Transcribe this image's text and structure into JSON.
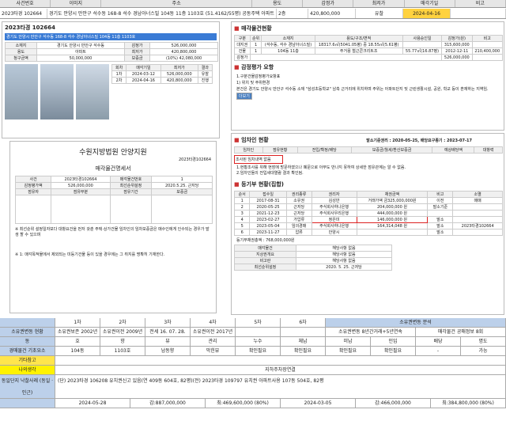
{
  "header": [
    "사건번호",
    "이미지",
    "주소",
    "용도",
    "감정가",
    "최저가",
    "매각기일",
    "비고"
  ],
  "summary": {
    "case": "2023타경 102664",
    "addr": "경기도 안양시 만안구 석수동 168-8 석수 경남아너스빌 104동 11층 1103호 (51.4162/55평) 공동주택 아파트",
    "area": "2층",
    "appraisal": "420,800,000",
    "stage": "유찰",
    "status": "2024-04-16"
  },
  "left": {
    "title": "2023타경 102664",
    "tags": "경기도 안양시 만안구 석수동 168-8 석수 경남아너스빌 104동 11층 1103호",
    "rows": [
      [
        "소재지",
        "경기도 안양시 만안구 석수동"
      ],
      [
        "용도",
        "아파트"
      ],
      [
        "감정가",
        "526,000,000"
      ],
      [
        "최저가",
        "420,800,000"
      ],
      [
        "보증금",
        "(10%) 42,080,000"
      ],
      [
        "청구금액",
        "50,000,000"
      ]
    ],
    "bid": [
      [
        "1차",
        "2024-03-12",
        "526,000,000",
        "유찰"
      ],
      [
        "2차",
        "2024-04-16",
        "420,800,000",
        "진행"
      ]
    ]
  },
  "notice": {
    "court": "수원지방법원 안양지원",
    "no": "2023타경102664",
    "title": "매각물건명세서",
    "note": "※ 최선순위 설정일자보다 대항요건을 먼저 갖춘 주택·상가건물 임차인의 임차보증금은 매수인에게 인수되는 경우가 발생 할 수 있으며",
    "foot": "※ 1: 매각목적물에서 제외되는 미등기건물 등이 있을 경우에는 그 취지를 명확히 기재한다."
  },
  "rights": {
    "title": "매각물건현황",
    "cols": [
      "구분",
      "순위",
      "소재지",
      "용도/구조/면적",
      "사용승인일",
      "감정가(원)",
      "비고"
    ],
    "r1": [
      "대지권",
      "1",
      "(석수동, 석수 경남아너스빌)",
      "18317.6㎡(5041.05평) 중 18.55㎡(5.61평)",
      "",
      "315,600,000",
      ""
    ],
    "r2": [
      "건물",
      "1",
      "104동 11층",
      "주거용 철근콘크리트조",
      "55.77㎡(16.87평)",
      "2012-12-11",
      "210,400,000"
    ],
    "total": [
      "감정가",
      "526,000,000"
    ],
    "appr_title": "감정평가 요항",
    "appr1": "1.구분건물감정평가요항표",
    "appr2": "1) 위치 및 주위환경",
    "appr3": "본건은 경기도 안양시 만안구 석수동 소재 \"삼성초등학교\" 남측 근거리에 위치하며 주위는 아파트단지 및 근린생활시설, 공원, 학교 등이 혼재하는 지역임."
  },
  "lease": {
    "title": "임차인 현황",
    "dates": "말소기준권리 : 2020-05-25, 배당요구종기 : 2023-07-17",
    "cols": [
      "임차인",
      "점유현황",
      "전입/확정/배당",
      "보증금/월세/환산보증금",
      "예상배당액",
      "대항력"
    ],
    "warn": "조사된 임차내역 없음",
    "etc1": "1.현황조사를 위해 현장에 방문하였으나 폐문으로 아무도 만나지 못하여 상세한 점유관계는 알 수 없음.",
    "etc2": "2.임차인들의 전입세대열람 결과 확인됨."
  },
  "reg": {
    "title": "등기부 현황(집합)",
    "cols": [
      "순서",
      "접수일",
      "권리종류",
      "권리자",
      "채권금액",
      "비고",
      "소멸"
    ],
    "rows": [
      [
        "1",
        "2017-08-31",
        "소유권",
        "김성만",
        "거래가액 금325,000,000원",
        "이전",
        "매매"
      ],
      [
        "2",
        "2020-05-25",
        "근저당",
        "주식회사하나은행",
        "204,000,000 원",
        "말소기준",
        ""
      ],
      [
        "3",
        "2021-12-23",
        "근저당",
        "주식회사우리은행",
        "444,000,000 원",
        "",
        ""
      ],
      [
        "4",
        "2023-02-27",
        "가압류",
        "정은미",
        "146,000,000 원",
        "말소",
        ""
      ],
      [
        "5",
        "2023-05-04",
        "임의경매",
        "주식회사하나은행",
        "164,314,048 원",
        "말소",
        "2023타경102664"
      ],
      [
        "6",
        "2023-11-27",
        "압류",
        "안양시",
        "",
        "말소",
        ""
      ]
    ],
    "claim": "768,000,000원",
    "fields": [
      [
        "매각물건",
        "해당사항 없음"
      ],
      [
        "지상권개요",
        "해당사항 없음"
      ],
      [
        "비고란",
        "해당사항 없음"
      ],
      [
        "최선순위설정",
        "2020. 5. 25. 근저당"
      ]
    ]
  },
  "bottom": {
    "r1": [
      "1차",
      "2차",
      "3차",
      "4차",
      "5차",
      "6차"
    ],
    "r1v": [
      "소유권보존 2002년",
      "소유권이전 2009년",
      "전세 16. 07. 28.",
      "소유권이전 2017년",
      "",
      "",
      "소유권변동 분석"
    ],
    "r1x": [
      "소유권변동 8년간거래+5년연속",
      "매각물건 공매정보 8회"
    ],
    "r2": [
      "104동",
      "1103호",
      "남동향",
      "막힌뷰",
      "확인필요",
      "확인필요",
      "확인필요",
      "확인필요",
      "-",
      "가능"
    ],
    "status": "지하주차장연결",
    "note": "(단) 2023타경 106208 유치권신고 있음(연 409동 604호, 82평)(전) 2023타경 109797 유치권 아파트사용 107동 504호, 82평",
    "dates": [
      "2024-05-28",
      "감:887,000,000",
      "최:469,600,000 (80%)",
      "2024-03-05",
      "감:466,000,000",
      "최:384,800,000 (80%)"
    ]
  }
}
